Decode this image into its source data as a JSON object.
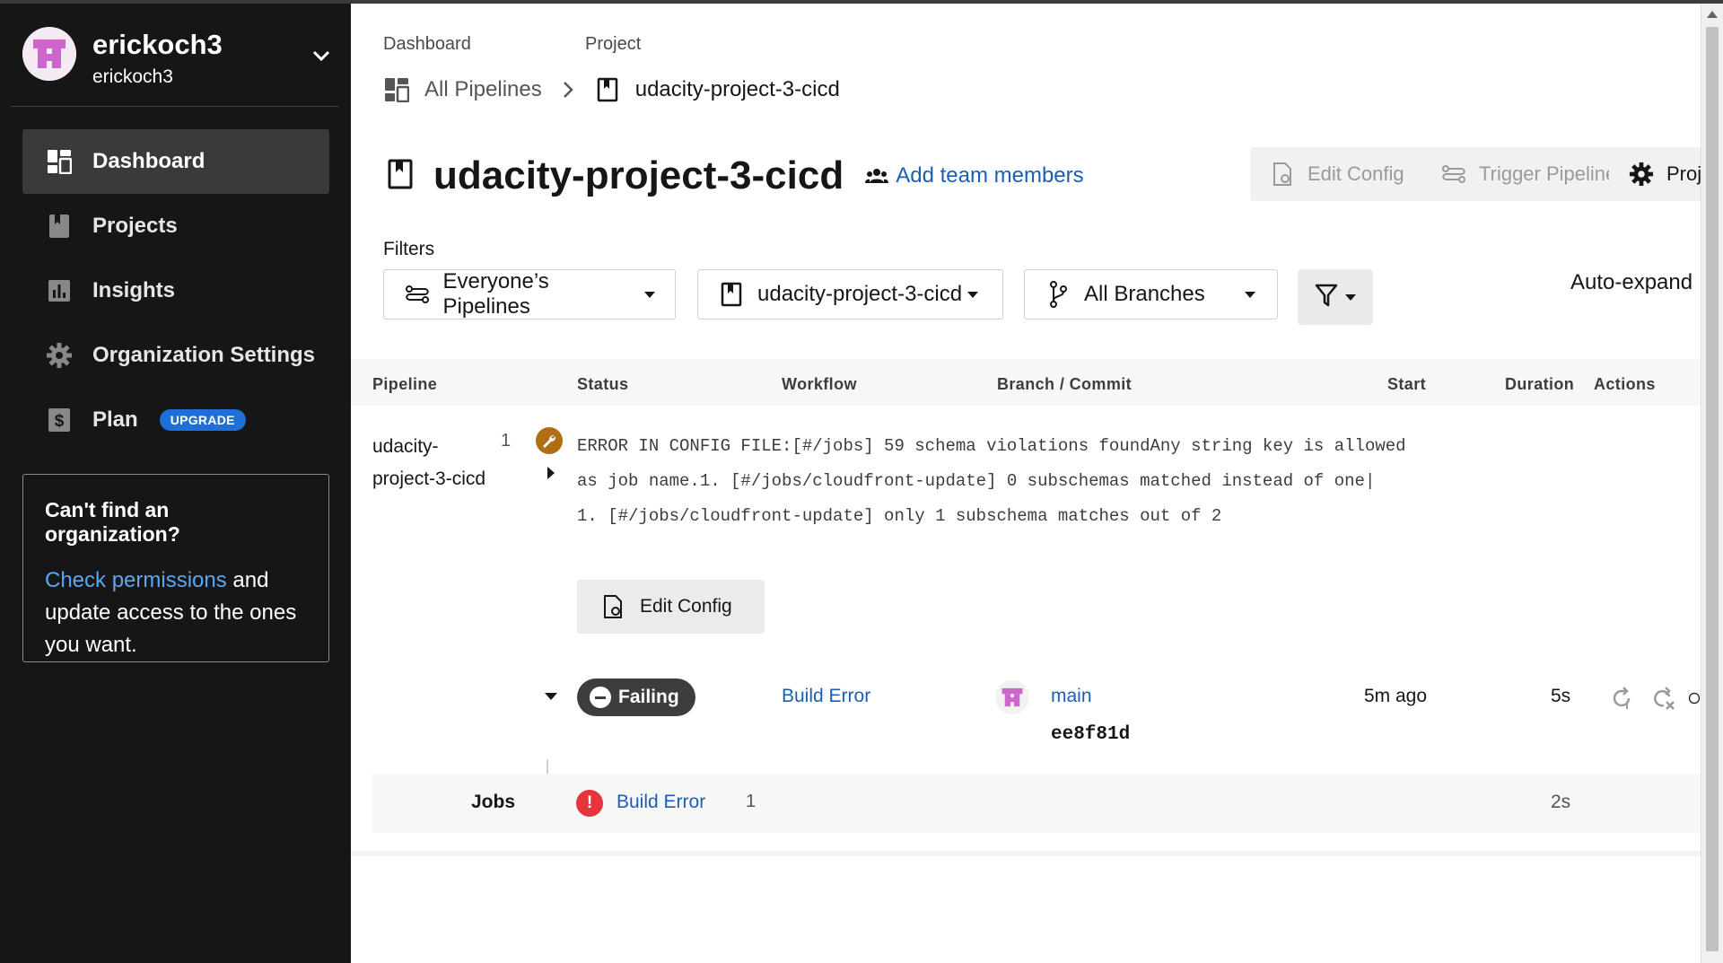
{
  "user": {
    "name": "erickoch3",
    "org": "erickoch3"
  },
  "sidebar": {
    "items": [
      {
        "label": "Dashboard",
        "icon": "dashboard-icon",
        "active": true
      },
      {
        "label": "Projects",
        "icon": "projects-icon"
      },
      {
        "label": "Insights",
        "icon": "insights-icon"
      },
      {
        "label": "Organization Settings",
        "icon": "gear-icon"
      },
      {
        "label": "Plan",
        "icon": "dollar-icon",
        "badge": "UPGRADE"
      }
    ],
    "org_box": {
      "title": "Can't find an organization?",
      "link": "Check permissions",
      "text": " and update access to the ones you want."
    }
  },
  "breadcrumb": {
    "dashboard_label": "Dashboard",
    "project_label": "Project",
    "all_pipelines": "All Pipelines",
    "current": "udacity-project-3-cicd"
  },
  "header": {
    "title": "udacity-project-3-cicd",
    "add_team": "Add team members",
    "edit_config": "Edit Config",
    "trigger_pipeline": "Trigger Pipeline",
    "project_settings": "Project Sett"
  },
  "filters": {
    "label": "Filters",
    "pipelines": "Everyone’s Pipelines",
    "project": "udacity-project-3-cicd",
    "branches": "All Branches",
    "auto_expand": "Auto-expand"
  },
  "table": {
    "columns": [
      "Pipeline",
      "Status",
      "Workflow",
      "Branch / Commit",
      "Start",
      "Duration",
      "Actions"
    ]
  },
  "pipeline": {
    "name": "udacity-project-3-cicd",
    "number": "1",
    "error_message": "ERROR IN CONFIG FILE:[#/jobs] 59 schema violations foundAny string key is allowed as job name.1. [#/jobs/cloudfront-update] 0 subschemas matched instead of one|   1. [#/jobs/cloudfront-update] only 1 subschema matches out of 2",
    "edit_config": "Edit Config",
    "status": "Failing",
    "workflow": "Build Error",
    "branch": "main",
    "commit": "ee8f81d",
    "start": "5m ago",
    "duration": "5s",
    "jobs_label": "Jobs",
    "job_name": "Build Error",
    "job_count": "1",
    "job_duration": "2s"
  },
  "colors": {
    "sidebar_bg": "#161616",
    "link": "#1a5fb4",
    "upgrade_badge": "#1f6fd6",
    "status_failing": "#3d3d3d",
    "config_error": "#b06e14",
    "job_error": "#e5343c",
    "avatar": "#cc66cc"
  }
}
